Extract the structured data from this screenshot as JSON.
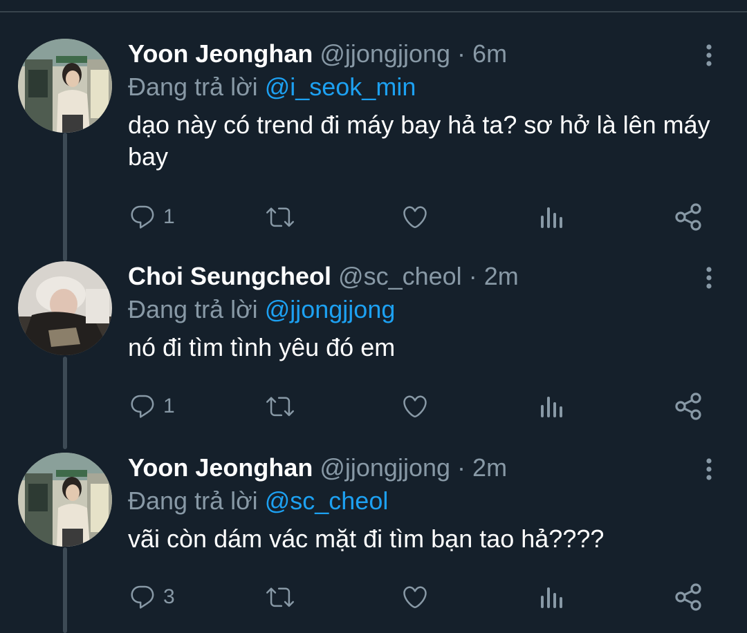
{
  "colors": {
    "background": "#15202b",
    "text": "#ffffff",
    "muted": "#8899a6",
    "link": "#1da1f2",
    "thread_line": "#3d4a55"
  },
  "tweets": [
    {
      "display_name": "Yoon Jeonghan",
      "handle": "@jjongjjong",
      "separator": "·",
      "time": "6m",
      "reply_prefix": "Đang trả lời",
      "reply_to": "@i_seok_min",
      "text": "dạo này có trend đi máy bay hả ta? sơ hở là lên máy bay",
      "reply_count": "1",
      "avatar_icon": "profile-photo"
    },
    {
      "display_name": "Choi Seungcheol",
      "handle": "@sc_cheol",
      "separator": "·",
      "time": "2m",
      "reply_prefix": "Đang trả lời",
      "reply_to": "@jjongjjong",
      "text": "nó đi tìm tình yêu đó em",
      "reply_count": "1",
      "avatar_icon": "profile-photo"
    },
    {
      "display_name": "Yoon Jeonghan",
      "handle": "@jjongjjong",
      "separator": "·",
      "time": "2m",
      "reply_prefix": "Đang trả lời",
      "reply_to": "@sc_cheol",
      "text": "vãi còn dám vác mặt đi tìm bạn tao hả????",
      "reply_count": "3",
      "avatar_icon": "profile-photo"
    }
  ],
  "action_icons": [
    "reply-icon",
    "retweet-icon",
    "like-icon",
    "analytics-icon",
    "share-icon",
    "more-options-icon"
  ]
}
